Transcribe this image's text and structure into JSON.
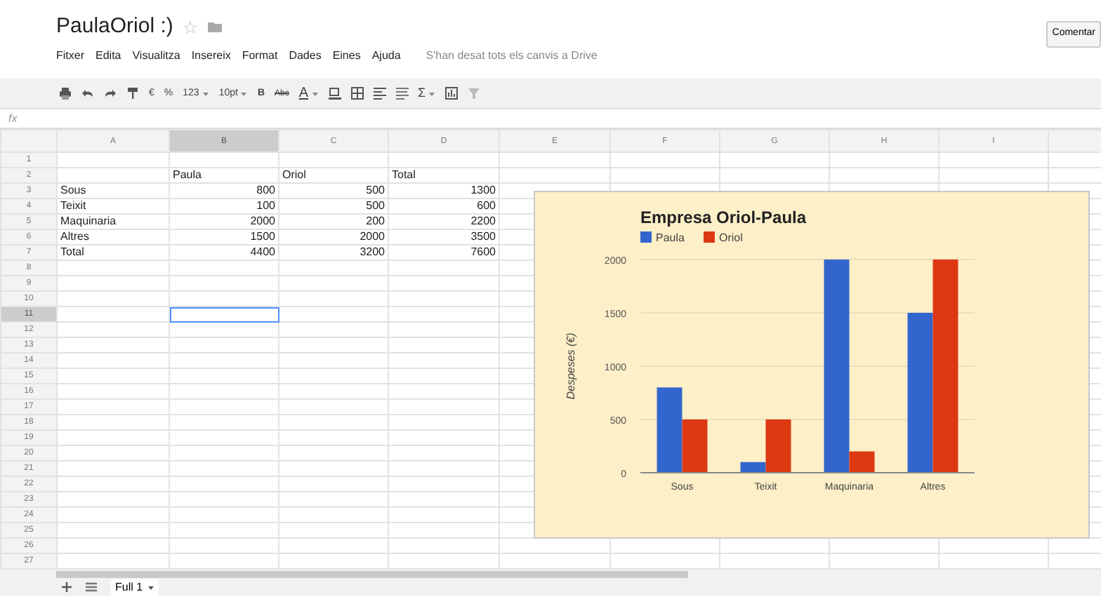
{
  "document": {
    "title": "PaulaOriol :)"
  },
  "comment_button": "Comentar",
  "menu": [
    "Fitxer",
    "Edita",
    "Visualitza",
    "Insereix",
    "Format",
    "Dades",
    "Eines",
    "Ajuda"
  ],
  "save_status": "S'han desat tots els canvis a Drive",
  "toolbar": {
    "currency": "€",
    "percent": "%",
    "number_format": "123",
    "font_size": "10pt",
    "bold": "B",
    "strikethrough": "Abc",
    "text_color": "A",
    "functions": "Σ"
  },
  "formula_bar": {
    "label": "fx"
  },
  "grid": {
    "columns": [
      {
        "label": "A",
        "selected": false
      },
      {
        "label": "B",
        "selected": true
      },
      {
        "label": "C",
        "selected": false
      },
      {
        "label": "D",
        "selected": false
      },
      {
        "label": "E",
        "selected": false
      },
      {
        "label": "F",
        "selected": false
      },
      {
        "label": "G",
        "selected": false
      },
      {
        "label": "H",
        "selected": false
      },
      {
        "label": "I",
        "selected": false
      }
    ],
    "rows": [
      {
        "number": "1",
        "selected": false,
        "cells": []
      },
      {
        "number": "2",
        "selected": false,
        "cells": [
          {
            "text": ""
          },
          {
            "text": "Paula",
            "kind": "text"
          },
          {
            "text": "Oriol",
            "kind": "text"
          },
          {
            "text": "Total",
            "kind": "text"
          }
        ]
      },
      {
        "number": "3",
        "selected": false,
        "cells": [
          {
            "text": "Sous",
            "kind": "text"
          },
          {
            "text": "800",
            "kind": "number"
          },
          {
            "text": "500",
            "kind": "number"
          },
          {
            "text": "1300",
            "kind": "number"
          }
        ]
      },
      {
        "number": "4",
        "selected": false,
        "cells": [
          {
            "text": "Teixit",
            "kind": "text"
          },
          {
            "text": "100",
            "kind": "number"
          },
          {
            "text": "500",
            "kind": "number"
          },
          {
            "text": "600",
            "kind": "number"
          }
        ]
      },
      {
        "number": "5",
        "selected": false,
        "cells": [
          {
            "text": "Maquinaria",
            "kind": "text"
          },
          {
            "text": "2000",
            "kind": "number"
          },
          {
            "text": "200",
            "kind": "number"
          },
          {
            "text": "2200",
            "kind": "number"
          }
        ]
      },
      {
        "number": "6",
        "selected": false,
        "cells": [
          {
            "text": "Altres",
            "kind": "text"
          },
          {
            "text": "1500",
            "kind": "number"
          },
          {
            "text": "2000",
            "kind": "number"
          },
          {
            "text": "3500",
            "kind": "number"
          }
        ]
      },
      {
        "number": "7",
        "selected": false,
        "cells": [
          {
            "text": "Total",
            "kind": "text"
          },
          {
            "text": "4400",
            "kind": "number"
          },
          {
            "text": "3200",
            "kind": "number"
          },
          {
            "text": "7600",
            "kind": "number"
          }
        ]
      },
      {
        "number": "8",
        "selected": false,
        "cells": []
      },
      {
        "number": "9",
        "selected": false,
        "cells": []
      },
      {
        "number": "10",
        "selected": false,
        "cells": []
      },
      {
        "number": "11",
        "selected": true,
        "cells": []
      },
      {
        "number": "12",
        "selected": false,
        "cells": []
      },
      {
        "number": "13",
        "selected": false,
        "cells": []
      },
      {
        "number": "14",
        "selected": false,
        "cells": []
      },
      {
        "number": "15",
        "selected": false,
        "cells": []
      },
      {
        "number": "16",
        "selected": false,
        "cells": []
      },
      {
        "number": "17",
        "selected": false,
        "cells": []
      },
      {
        "number": "18",
        "selected": false,
        "cells": []
      },
      {
        "number": "19",
        "selected": false,
        "cells": []
      },
      {
        "number": "20",
        "selected": false,
        "cells": []
      },
      {
        "number": "21",
        "selected": false,
        "cells": []
      },
      {
        "number": "22",
        "selected": false,
        "cells": []
      },
      {
        "number": "23",
        "selected": false,
        "cells": []
      },
      {
        "number": "24",
        "selected": false,
        "cells": []
      },
      {
        "number": "25",
        "selected": false,
        "cells": []
      },
      {
        "number": "26",
        "selected": false,
        "cells": []
      },
      {
        "number": "27",
        "selected": false,
        "cells": []
      }
    ]
  },
  "chart": {
    "chart_data": {
      "type": "bar",
      "title": "Empresa Oriol-Paula",
      "ylabel": "Despeses (€)",
      "categories": [
        "Sous",
        "Teixit",
        "Maquinaria",
        "Altres"
      ],
      "series": [
        {
          "name": "Paula",
          "color": "#3366cc",
          "values": [
            800,
            100,
            2000,
            1500
          ]
        },
        {
          "name": "Oriol",
          "color": "#dc3912",
          "values": [
            500,
            500,
            200,
            2000
          ]
        }
      ],
      "ylim": [
        0,
        2000
      ],
      "yticks": [
        {
          "value": 0,
          "label": "0"
        },
        {
          "value": 500,
          "label": "500"
        },
        {
          "value": 1000,
          "label": "1000"
        },
        {
          "value": 1500,
          "label": "1500"
        },
        {
          "value": 2000,
          "label": "2000"
        }
      ],
      "grid": true,
      "legend": "top"
    }
  },
  "sheet_tabs": [
    {
      "label": "Full 1",
      "selected": true
    }
  ]
}
